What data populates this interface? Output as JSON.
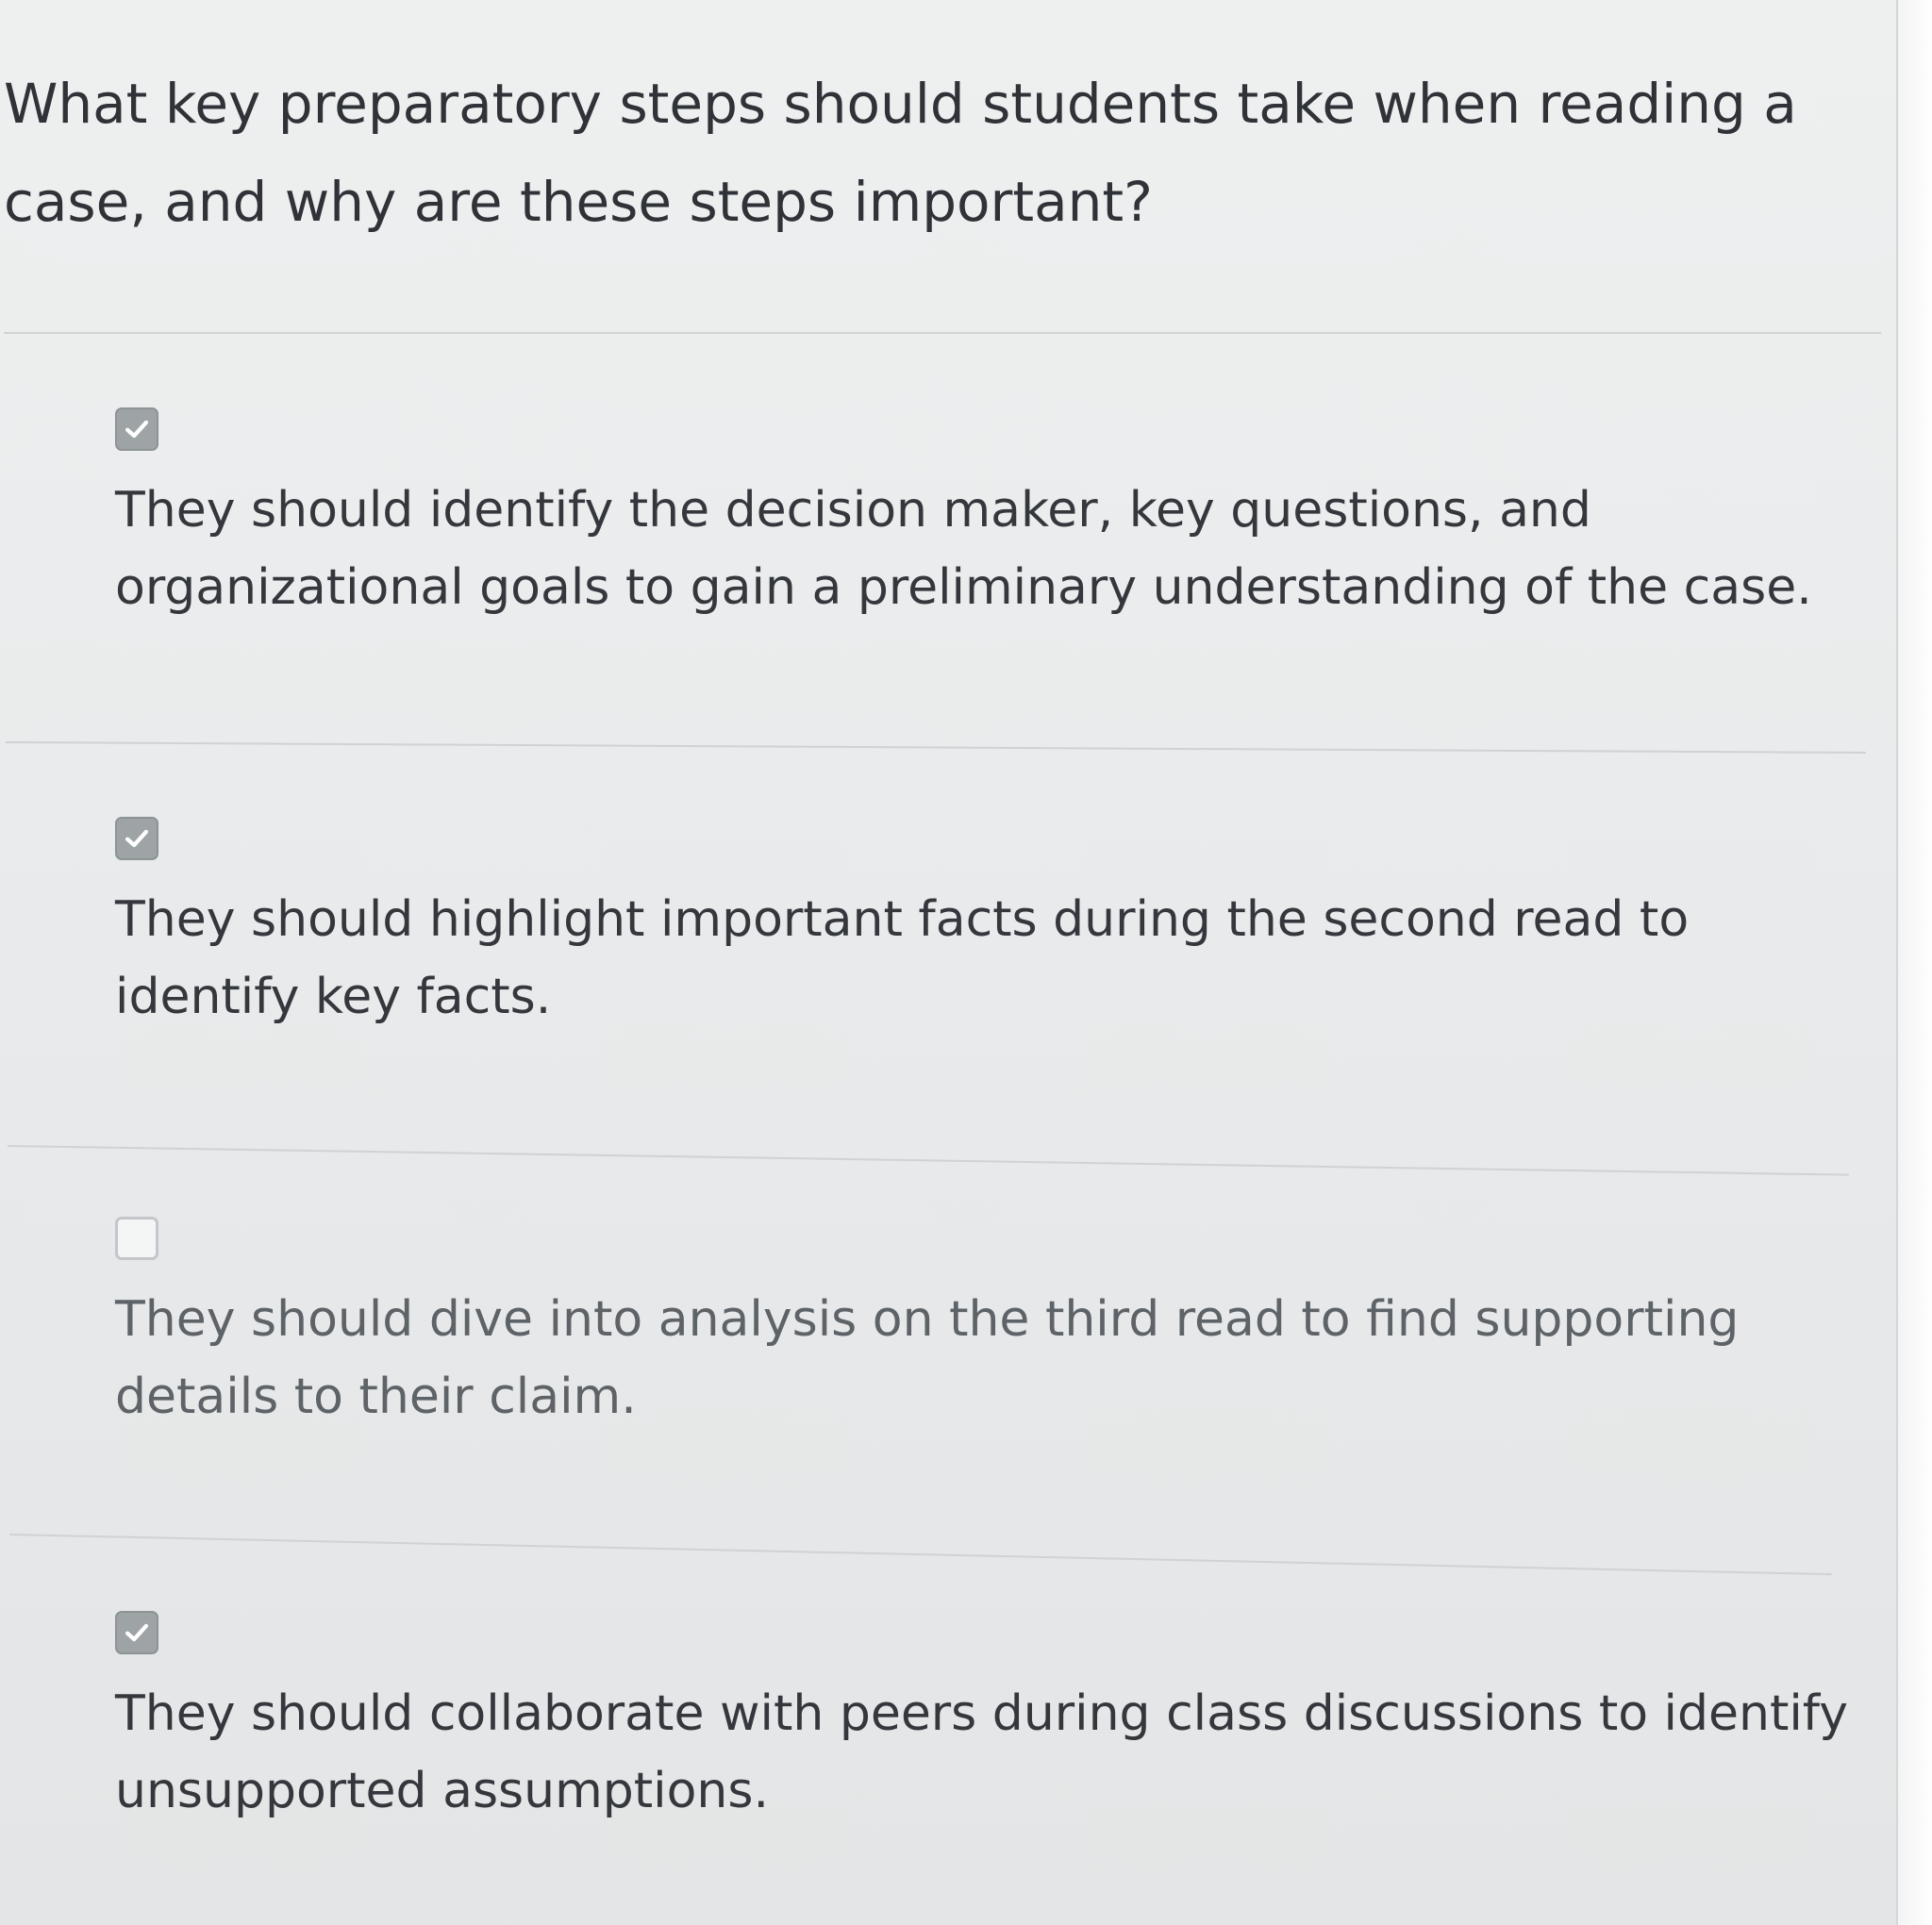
{
  "question": {
    "text": "What key preparatory steps should students take when reading a case, and why are these steps important?"
  },
  "options": [
    {
      "checked": true,
      "text": "They should identify the decision maker, key questions, and organizational goals to gain a preliminary understanding of the case."
    },
    {
      "checked": true,
      "text": "They should highlight important facts during the second read to identify key facts."
    },
    {
      "checked": false,
      "text": "They should dive into analysis on the third read to find supporting details to their claim."
    },
    {
      "checked": true,
      "text": "They should collaborate with peers during class discussions to identify unsupported assumptions."
    }
  ],
  "icons": {
    "checkmark": "checkmark-icon"
  },
  "colors": {
    "checkbox_checked": "#9ea3a6",
    "checkbox_unchecked_border": "#c3c7ca",
    "text": "#34383d",
    "divider": "#cfd3d6"
  }
}
